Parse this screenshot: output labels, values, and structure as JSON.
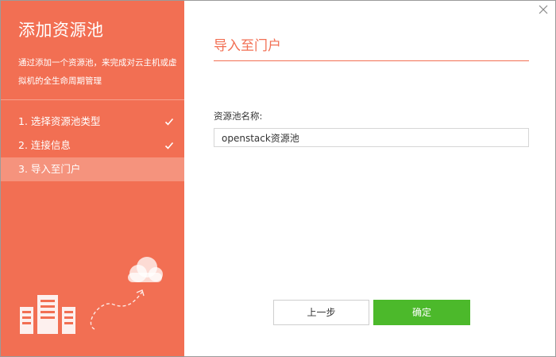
{
  "sidebar": {
    "title": "添加资源池",
    "description": "通过添加一个资源池，来完成对云主机或虚拟机的全生命周期管理",
    "steps": [
      {
        "label": "1. 选择资源池类型",
        "completed": true
      },
      {
        "label": "2. 连接信息",
        "completed": true
      },
      {
        "label": "3. 导入至门户",
        "active": true
      }
    ],
    "illustration_icons": [
      "server-icon",
      "cloud-icon"
    ]
  },
  "main": {
    "section_title": "导入至门户",
    "pool_name_label": "资源池名称:",
    "pool_name_value": "openstack资源池"
  },
  "footer": {
    "prev_label": "上一步",
    "confirm_label": "确定"
  },
  "colors": {
    "accent": "#f26f53",
    "active_step": "#f5937d",
    "confirm": "#4cb92b"
  }
}
